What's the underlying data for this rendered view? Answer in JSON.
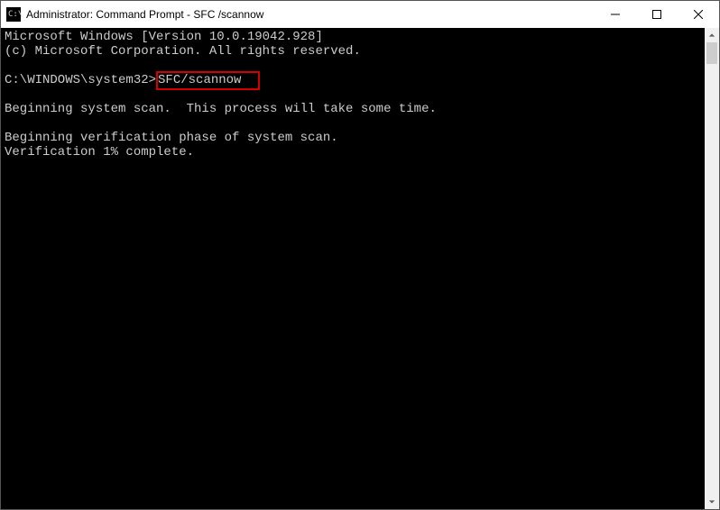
{
  "titlebar": {
    "icon_glyph": "C:\\",
    "title": "Administrator: Command Prompt - SFC /scannow"
  },
  "terminal": {
    "line1": "Microsoft Windows [Version 10.0.19042.928]",
    "line2": "(c) Microsoft Corporation. All rights reserved.",
    "blank1": "",
    "prompt_prefix": "C:\\WINDOWS\\system32>",
    "command": "SFC/scannow",
    "blank2": "",
    "line4": "Beginning system scan.  This process will take some time.",
    "blank3": "",
    "line5": "Beginning verification phase of system scan.",
    "line6": "Verification 1% complete."
  }
}
